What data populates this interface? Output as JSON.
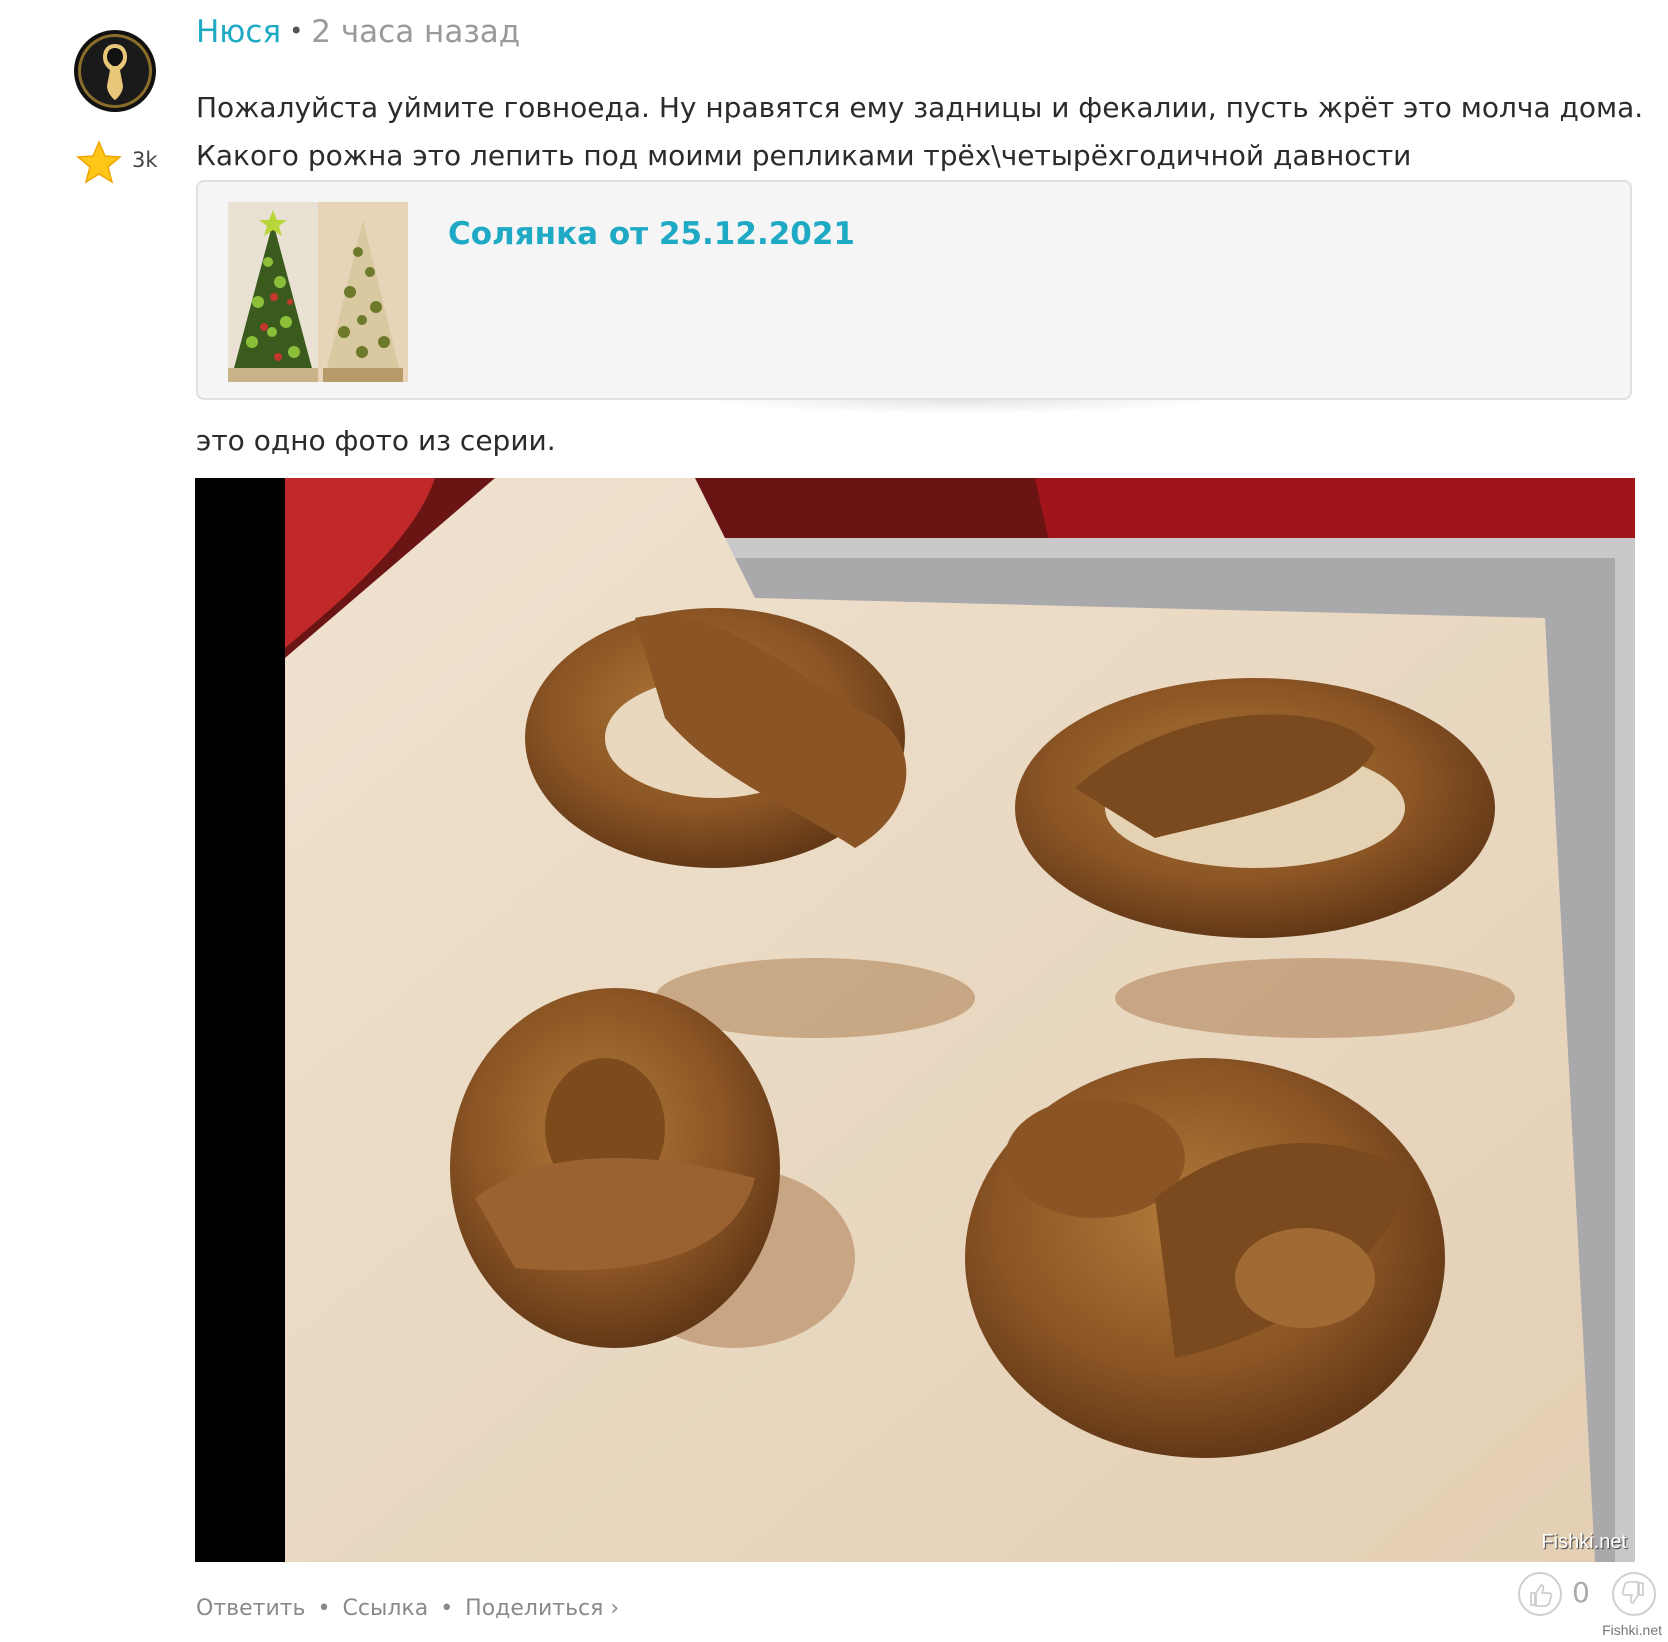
{
  "comment": {
    "author": "Нюся",
    "separator": "•",
    "time": "2 часа назад",
    "rating": "3k",
    "text_lines": [
      "Пожалуйста уймите говноеда. Ну нравятся ему задницы и фекалии, пусть жрёт это молча дома.",
      "Какого рожна это лепить под моими репликами трёх\\четырёхгодичной давности"
    ],
    "link_card": {
      "title": "Солянка от 25.12.2021",
      "thumb_icon": "christmas-tree-salad-thumbnail"
    },
    "caption": "это одно фото из серии.",
    "photo": {
      "watermark": "Fishki.net"
    }
  },
  "footer": {
    "reply": "Ответить",
    "link": "Ссылка",
    "share": "Поделиться ›",
    "dot": "•"
  },
  "votes": {
    "score": "0"
  },
  "corner_watermark": "Fishki.net",
  "colors": {
    "accent": "#1ea9c5",
    "muted": "#9a9a9a",
    "text": "#2b2b2b"
  }
}
